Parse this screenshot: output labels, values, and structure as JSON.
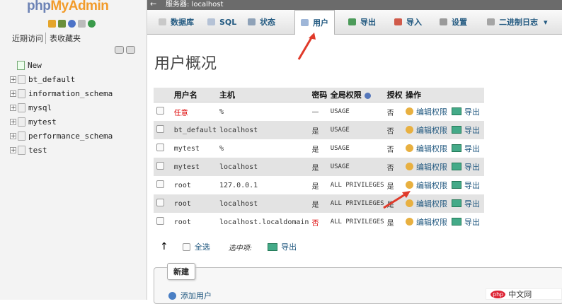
{
  "nav": {
    "logo": "phpMyAdmin",
    "tabs": [
      "近期访问",
      "表收藏夹"
    ],
    "tree": [
      {
        "label": "New",
        "type": "new"
      },
      {
        "label": "bt_default",
        "type": "db"
      },
      {
        "label": "information_schema",
        "type": "db"
      },
      {
        "label": "mysql",
        "type": "db"
      },
      {
        "label": "mytest",
        "type": "db"
      },
      {
        "label": "performance_schema",
        "type": "db"
      },
      {
        "label": "test",
        "type": "db"
      }
    ]
  },
  "server_bar": {
    "label": "服务器: localhost"
  },
  "tabs": [
    {
      "label": "数据库",
      "active": false,
      "icon": "database-icon"
    },
    {
      "label": "SQL",
      "active": false,
      "icon": "sql-icon"
    },
    {
      "label": "状态",
      "active": false,
      "icon": "status-icon"
    },
    {
      "label": "用户",
      "active": true,
      "icon": "users-icon"
    },
    {
      "label": "导出",
      "active": false,
      "icon": "export-icon"
    },
    {
      "label": "导入",
      "active": false,
      "icon": "import-icon"
    },
    {
      "label": "设置",
      "active": false,
      "icon": "wrench-icon"
    },
    {
      "label": "二进制日志",
      "active": false,
      "icon": "binlog-icon"
    }
  ],
  "main": {
    "title": "用户概况",
    "table": {
      "headers": [
        "",
        "用户名",
        "主机",
        "密码",
        "全局权限",
        "授权",
        "操作"
      ],
      "rows": [
        {
          "user": "任意",
          "host": "%",
          "password": "—",
          "privileges": "USAGE",
          "grant": "否"
        },
        {
          "user": "bt_default",
          "host": "localhost",
          "password": "是",
          "privileges": "USAGE",
          "grant": "否"
        },
        {
          "user": "mytest",
          "host": "%",
          "password": "是",
          "privileges": "USAGE",
          "grant": "否"
        },
        {
          "user": "mytest",
          "host": "localhost",
          "password": "是",
          "privileges": "USAGE",
          "grant": "否"
        },
        {
          "user": "root",
          "host": "127.0.0.1",
          "password": "是",
          "privileges": "ALL PRIVILEGES",
          "grant": "是"
        },
        {
          "user": "root",
          "host": "localhost",
          "password": "是",
          "privileges": "ALL PRIVILEGES",
          "grant": "是"
        },
        {
          "user": "root",
          "host": "localhost.localdomain",
          "password": "否",
          "privileges": "ALL PRIVILEGES",
          "grant": "是"
        }
      ],
      "edit_label": "编辑权限",
      "export_label": "导出"
    },
    "bulk": {
      "check_all": "全选",
      "with_selected": "选中项:",
      "export": "导出"
    },
    "new_section": {
      "legend": "新建",
      "add_user": "添加用户"
    }
  },
  "watermark": {
    "badge": "php",
    "text": "中文网"
  },
  "colors": {
    "link": "#235a81",
    "highlight_arrow": "#e03a2a",
    "no_password": "#dd0000"
  }
}
